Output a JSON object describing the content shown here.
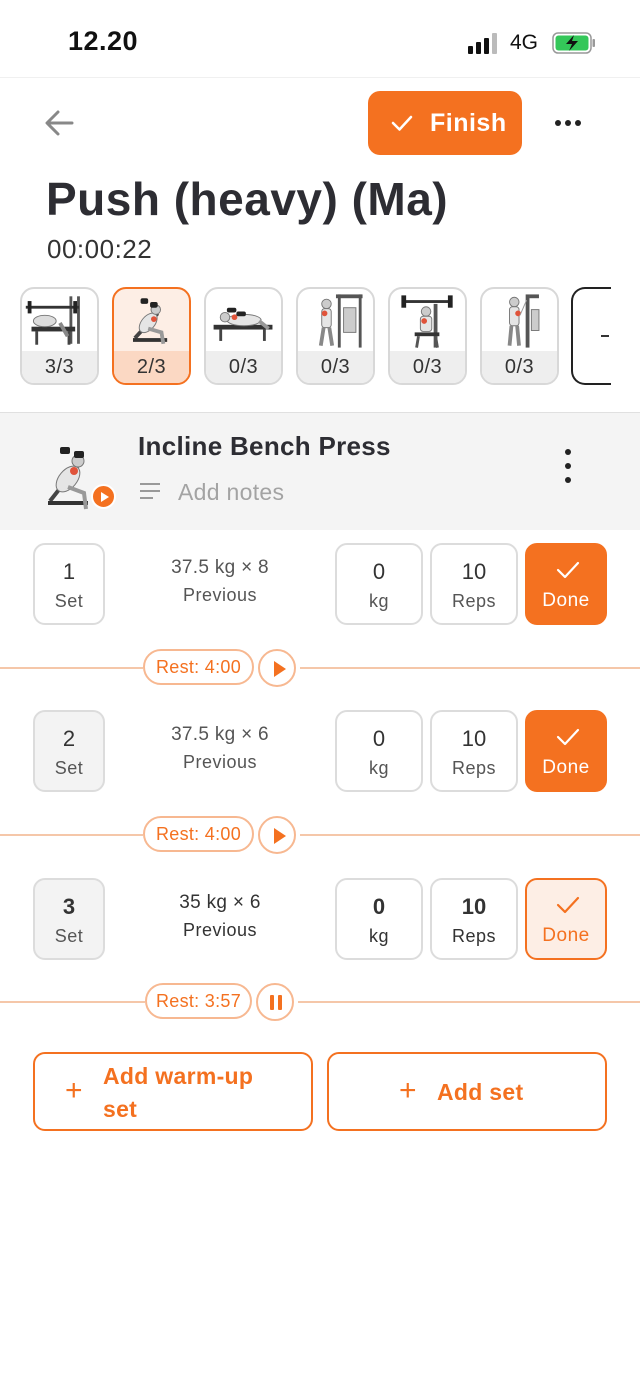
{
  "status_bar": {
    "time": "12.20",
    "network": "4G"
  },
  "header": {
    "finish_label": "Finish",
    "workout_title": "Push (heavy) (Ma)",
    "elapsed": "00:00:22"
  },
  "exercise_strip": [
    {
      "progress": "3/3",
      "active": false
    },
    {
      "progress": "2/3",
      "active": true
    },
    {
      "progress": "0/3",
      "active": false
    },
    {
      "progress": "0/3",
      "active": false
    },
    {
      "progress": "0/3",
      "active": false
    },
    {
      "progress": "0/3",
      "active": false
    }
  ],
  "exercise": {
    "name": "Incline Bench Press",
    "notes_placeholder": "Add notes"
  },
  "sets": [
    {
      "number": "1",
      "number_label": "Set",
      "previous": "37.5 kg × 8",
      "previous_label": "Previous",
      "kg": "0",
      "kg_label": "kg",
      "reps": "10",
      "reps_label": "Reps",
      "done_label": "Done",
      "completed": true
    },
    {
      "number": "2",
      "number_label": "Set",
      "previous": "37.5 kg × 6",
      "previous_label": "Previous",
      "kg": "0",
      "kg_label": "kg",
      "reps": "10",
      "reps_label": "Reps",
      "done_label": "Done",
      "completed": true
    },
    {
      "number": "3",
      "number_label": "Set",
      "previous": "35 kg × 6",
      "previous_label": "Previous",
      "kg": "0",
      "kg_label": "kg",
      "reps": "10",
      "reps_label": "Reps",
      "done_label": "Done",
      "completed": false
    }
  ],
  "rests": [
    {
      "label": "Rest: 4:00",
      "state": "play"
    },
    {
      "label": "Rest: 4:00",
      "state": "play"
    },
    {
      "label": "Rest: 3:57",
      "state": "pause"
    }
  ],
  "actions": {
    "add_warmup_line1": "Add warm-up",
    "add_warmup_line2": "set",
    "add_set": "Add set",
    "plus": "+"
  },
  "colors": {
    "accent": "#f47120",
    "accent_light": "#fdeee5",
    "text": "#2d2d33"
  }
}
